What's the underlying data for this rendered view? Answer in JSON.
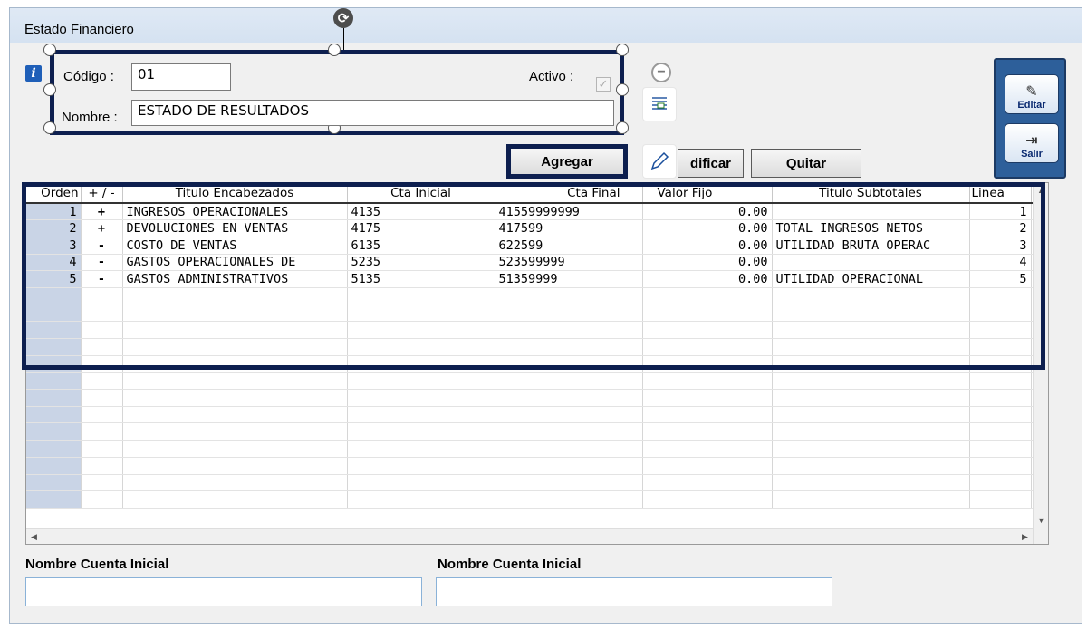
{
  "window": {
    "title": "Estado Financiero"
  },
  "form": {
    "codigo_label": "Código :",
    "codigo_value": "01",
    "nombre_label": "Nombre :",
    "nombre_value": "ESTADO DE RESULTADOS",
    "activo_label": "Activo :",
    "activo_checked": true
  },
  "buttons": {
    "agregar": "Agregar",
    "modificar": "dificar",
    "quitar": "Quitar"
  },
  "toolbar": {
    "editar": "Editar",
    "salir": "Salir"
  },
  "grid": {
    "columns": [
      "Orden",
      "+ / -",
      "Titulo Encabezados",
      "Cta Inicial",
      "Cta Final",
      "Valor Fijo",
      "Titulo Subtotales",
      "Linea"
    ],
    "rows": [
      {
        "orden": "1",
        "sign": "+",
        "titulo": "INGRESOS OPERACIONALES",
        "cta_inicial": "4135",
        "cta_final": "41559999999",
        "valor_fijo": "0.00",
        "subtotal": "",
        "linea": "1"
      },
      {
        "orden": "2",
        "sign": "+",
        "titulo": "DEVOLUCIONES EN VENTAS",
        "cta_inicial": "4175",
        "cta_final": "417599",
        "valor_fijo": "0.00",
        "subtotal": "TOTAL INGRESOS NETOS",
        "linea": "2"
      },
      {
        "orden": "3",
        "sign": "-",
        "titulo": "COSTO DE VENTAS",
        "cta_inicial": "6135",
        "cta_final": "622599",
        "valor_fijo": "0.00",
        "subtotal": "UTILIDAD BRUTA OPERAC",
        "linea": "3"
      },
      {
        "orden": "4",
        "sign": "-",
        "titulo": "GASTOS OPERACIONALES DE",
        "cta_inicial": "5235",
        "cta_final": "523599999",
        "valor_fijo": "0.00",
        "subtotal": "",
        "linea": "4"
      },
      {
        "orden": "5",
        "sign": "-",
        "titulo": "GASTOS ADMINISTRATIVOS",
        "cta_inicial": "5135",
        "cta_final": "51359999",
        "valor_fijo": "0.00",
        "subtotal": "UTILIDAD OPERACIONAL",
        "linea": "5"
      }
    ]
  },
  "footer": {
    "label_left": "Nombre Cuenta Inicial",
    "label_right": "Nombre Cuenta Inicial"
  },
  "colors": {
    "selection": "#0d1f4f",
    "orden_col": "#c9d4e6",
    "toolbar": "#2d5f9a"
  },
  "icons": [
    "info-icon",
    "rotate-icon",
    "minus-circle-icon",
    "text-wrap-icon",
    "pen-icon",
    "fill-icon",
    "border-icon",
    "edit-icon",
    "exit-door-icon"
  ]
}
